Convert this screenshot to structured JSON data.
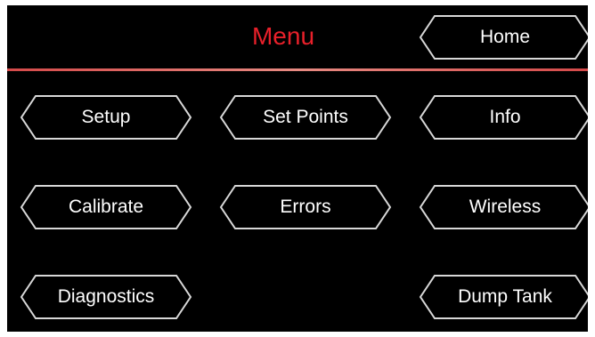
{
  "header": {
    "title": "Menu",
    "title_color": "#e8202a",
    "divider_color": "#d54a4a"
  },
  "buttons": {
    "home": "Home",
    "setup": "Setup",
    "set_points": "Set Points",
    "info": "Info",
    "calibrate": "Calibrate",
    "errors": "Errors",
    "wireless": "Wireless",
    "diagnostics": "Diagnostics",
    "dump_tank": "Dump Tank"
  },
  "style": {
    "background": "#000000",
    "button_outline": "#d8d8d8",
    "button_text": "#ffffff"
  }
}
